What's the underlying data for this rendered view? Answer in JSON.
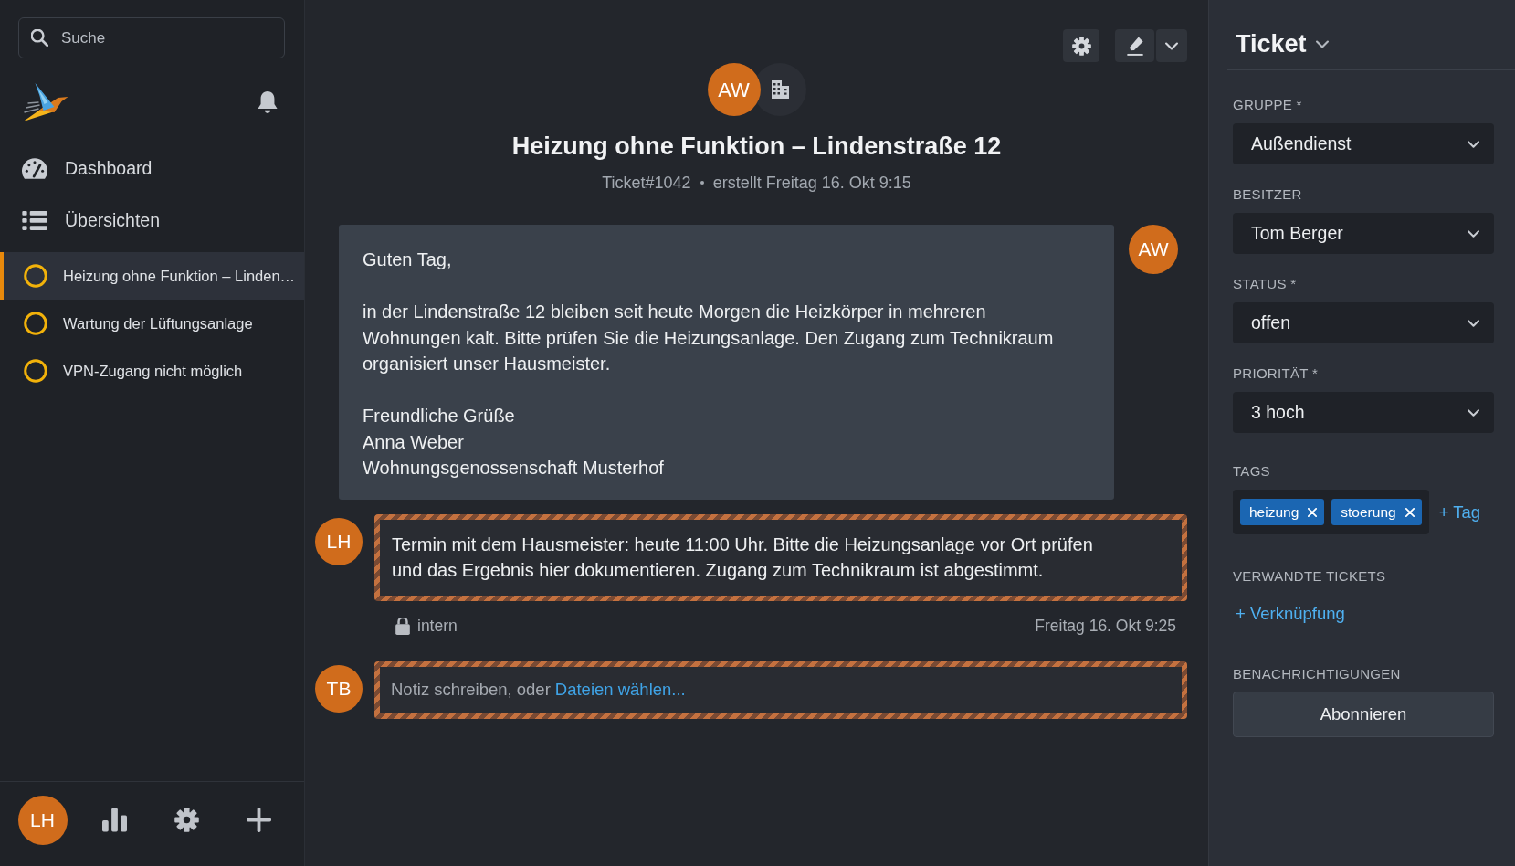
{
  "search": {
    "placeholder": "Suche"
  },
  "navigation": [
    {
      "kind": "dashboard",
      "label": "Dashboard"
    },
    {
      "kind": "overviews",
      "label": "Übersichten"
    }
  ],
  "open_tickets": [
    {
      "title": "Heizung ohne Funktion – Linden…",
      "selected": true
    },
    {
      "title": "Wartung der Lüftungsanlage",
      "selected": false
    },
    {
      "title": "VPN-Zugang nicht möglich",
      "selected": false
    }
  ],
  "user_avatar": {
    "initials": "LH"
  },
  "ticket": {
    "customer_initials": "AW",
    "title": "Heizung ohne Funktion – Lindenstraße 12",
    "number": "Ticket#1042",
    "created": "erstellt Freitag 16. Okt 9:15"
  },
  "articles": [
    {
      "kind": "customer",
      "initials": "AW",
      "internal": false,
      "paragraphs": [
        "Guten Tag,",
        "in der Lindenstraße 12 bleiben seit heute Morgen die Heizkörper in mehreren Wohnungen kalt. Bitte prüfen Sie die Heizungsanlage. Den Zugang zum Technikraum organisiert unser Hausmeister.",
        "Freundliche Grüße\nAnna Weber\nWohnungsgenossenschaft Musterhof"
      ]
    },
    {
      "kind": "agent",
      "initials": "LH",
      "internal": true,
      "paragraphs": [
        "Termin mit dem Hausmeister: heute 11:00 Uhr. Bitte die Heizungsanlage vor Ort prüfen und das Ergebnis hier dokumentieren. Zugang zum Technikraum ist abgestimmt."
      ],
      "visibility": "intern",
      "time": "Freitag 16. Okt 9:25"
    }
  ],
  "composer": {
    "initials": "TB",
    "internal": true,
    "placeholder": "Notiz schreiben, oder",
    "link": "Dateien wählen..."
  },
  "ticket_panel": {
    "title": "Ticket",
    "fields": [
      {
        "label": "GRUPPE *",
        "value": "Außendienst"
      },
      {
        "label": "BESITZER",
        "value": "Tom Berger"
      },
      {
        "label": "STATUS *",
        "value": "offen"
      },
      {
        "label": "PRIORITÄT *",
        "value": "3 hoch"
      }
    ],
    "tags": {
      "label": "TAGS",
      "items": [
        "heizung",
        "stoerung"
      ],
      "add_link": "+ Tag"
    },
    "related": {
      "label": "VERWANDTE TICKETS",
      "link": "+ Verknüpfung"
    },
    "notifications": {
      "label": "BENACHRICHTIGUNGEN",
      "button": "Abonnieren"
    }
  }
}
